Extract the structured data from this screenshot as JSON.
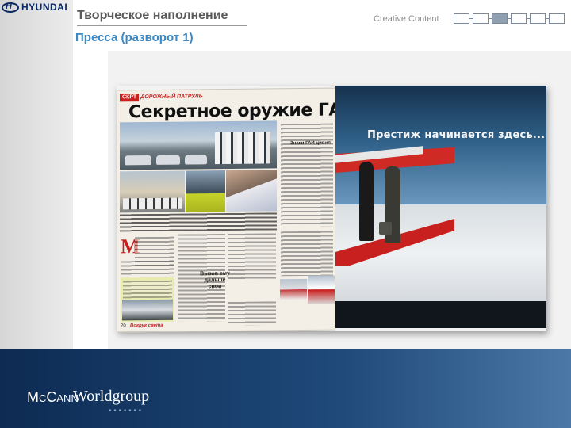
{
  "logo": {
    "text": "HYUNDAI"
  },
  "header": {
    "title": "Творческое наполнение",
    "subtitle": "Пресса (разворот 1)",
    "section_label": "Creative Content",
    "progress": {
      "total": 6,
      "active": 3
    }
  },
  "magazine": {
    "left_page": {
      "rubric_tag": "СКРТ",
      "rubric": "ДОРОЖНЫЙ ПАТРУЛЬ",
      "headline": "Секретное оружие ГАИ",
      "box_title": "Знаки ГАИ цивил",
      "mini_heading": "Вызов ему дальше свои",
      "folio_page": "20",
      "folio_brand": "Вокруг света"
    },
    "right_page": {
      "headline": "Престиж начинается здесь..."
    }
  },
  "footer": {
    "brand_prefix": "McCann",
    "brand_name": "Worldgroup",
    "dots": "• • • • • • •"
  },
  "colors": {
    "title_gray": "#5a5a5a",
    "subtitle_blue": "#3a88c4",
    "footer_navy": "#0d2b53",
    "footer_blue": "#4b78a6",
    "magazine_red": "#c8201f"
  }
}
